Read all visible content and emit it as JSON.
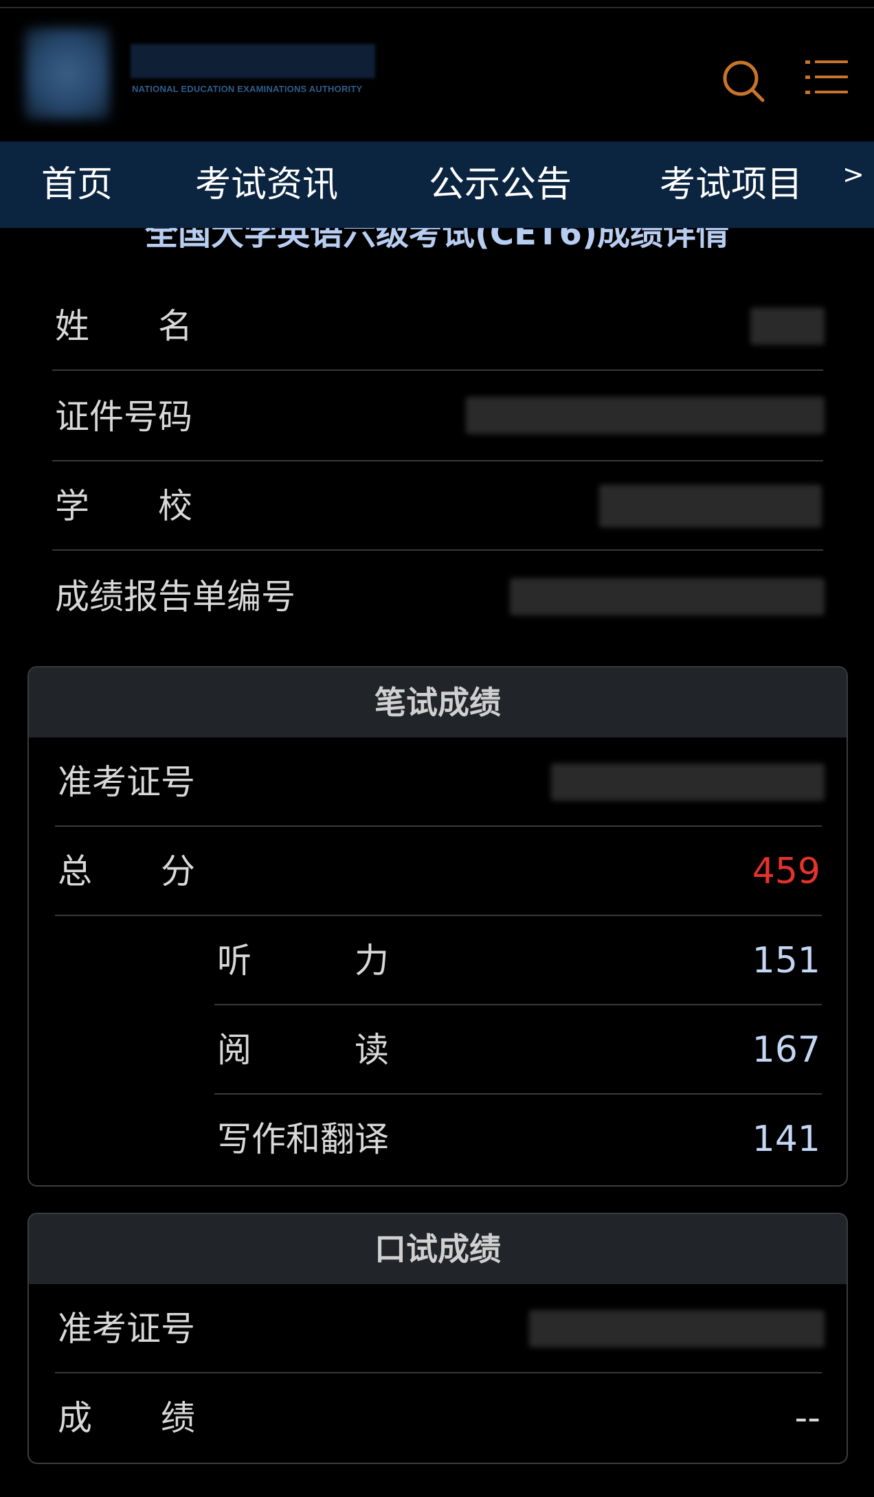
{
  "header": {
    "logo_subtitle": "NATIONAL EDUCATION EXAMINATIONS AUTHORITY",
    "icons": {
      "search": "search-icon",
      "menu": "list-menu-icon"
    },
    "accent_color": "#c8742a"
  },
  "nav": {
    "items": [
      {
        "label": "首页"
      },
      {
        "label": "考试资讯"
      },
      {
        "label": "公示公告"
      },
      {
        "label": "考试项目"
      }
    ],
    "more": ">"
  },
  "page_title": "全国大学英语六级考试(CET6)成绩详情",
  "candidate_info": {
    "name_label": "姓　　名",
    "id_label": "证件号码",
    "school_label": "学　　校",
    "report_no_label": "成绩报告单编号"
  },
  "written": {
    "title": "笔试成绩",
    "ticket_label": "准考证号",
    "total_label": "总　　分",
    "total_value": "459",
    "listening_label": "听　　　力",
    "listening_value": "151",
    "reading_label": "阅　　　读",
    "reading_value": "167",
    "writing_label": "写作和翻译",
    "writing_value": "141"
  },
  "oral": {
    "title": "口试成绩",
    "ticket_label": "准考证号",
    "score_label": "成　　绩",
    "score_value": "--"
  },
  "colors": {
    "background": "#000000",
    "nav_bg": "#0b2440",
    "total_score": "#e5332c",
    "score": "#c4d6f5"
  }
}
